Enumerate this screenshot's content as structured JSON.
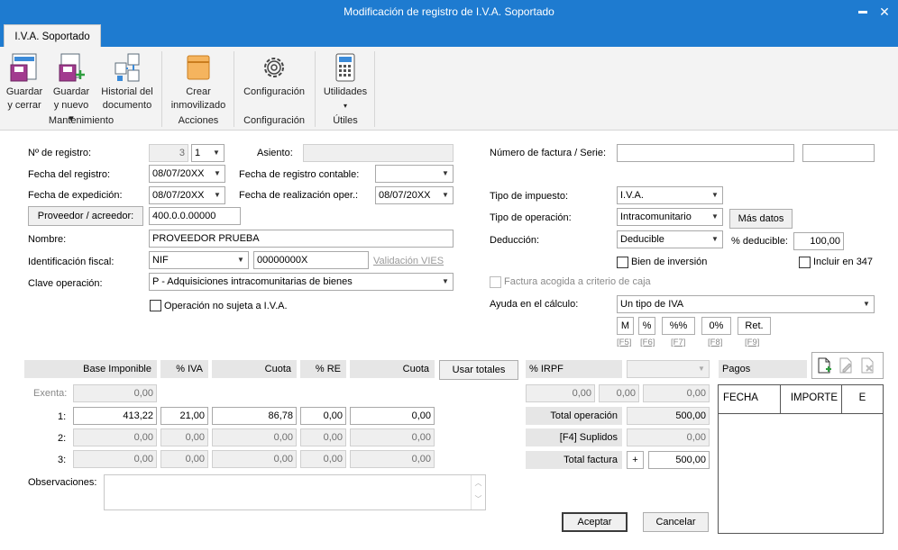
{
  "window": {
    "title": "Modificación de registro de I.V.A. Soportado",
    "minimize": "▬",
    "close": "✕"
  },
  "ribbon": {
    "tab": "I.V.A. Soportado",
    "buttons": {
      "guardar_cerrar": [
        "Guardar",
        "y cerrar"
      ],
      "guardar_nuevo": [
        "Guardar",
        "y nuevo ▾"
      ],
      "historial": [
        "Historial del",
        "documento"
      ],
      "crear": [
        "Crear",
        "inmovilizado"
      ],
      "config": [
        "Configuración"
      ],
      "utilidades": [
        "Utilidades",
        "▾"
      ]
    },
    "groups": {
      "mantenimiento": "Mantenimiento",
      "acciones": "Acciones",
      "configuracion": "Configuración",
      "utiles": "Útiles"
    }
  },
  "form": {
    "n_registro_label": "Nº de registro:",
    "n_registro": "3",
    "n_registro_serie": "1",
    "asiento_label": "Asiento:",
    "asiento": "",
    "fecha_registro_label": "Fecha del registro:",
    "fecha_registro": "08/07/20XX",
    "fecha_contable_label": "Fecha de registro contable:",
    "fecha_contable": "",
    "fecha_expedicion_label": "Fecha de expedición:",
    "fecha_expedicion": "08/07/20XX",
    "fecha_realizacion_label": "Fecha de realización oper.:",
    "fecha_realizacion": "08/07/20XX",
    "proveedor_button": "Proveedor / acreedor:",
    "proveedor_code": "400.0.0.00000",
    "nombre_label": "Nombre:",
    "nombre": "PROVEEDOR PRUEBA",
    "ident_label": "Identificación fiscal:",
    "ident_tipo": "NIF",
    "ident_num": "00000000X",
    "vies_link": "Validación VIES",
    "clave_label": "Clave operación:",
    "clave": "P - Adquisiciones intracomunitarias de bienes",
    "no_sujeta_label": "Operación no sujeta a I.V.A.",
    "factura_label": "Número de factura / Serie:",
    "factura": "",
    "serie": "",
    "tipo_impuesto_label": "Tipo de impuesto:",
    "tipo_impuesto": "I.V.A.",
    "tipo_operacion_label": "Tipo de operación:",
    "tipo_operacion": "Intracomunitario",
    "mas_datos": "Más datos",
    "deduccion_label": "Deducción:",
    "deduccion": "Deducible",
    "pct_deducible_label": "% deducible:",
    "pct_deducible": "100,00",
    "bien_inversion_label": "Bien de inversión",
    "incluir_347_label": "Incluir en 347",
    "criterio_caja_label": "Factura acogida a criterio de caja",
    "ayuda_label": "Ayuda en el cálculo:",
    "ayuda": "Un tipo de IVA",
    "calc_buttons": [
      {
        "label": "M",
        "key": "[F5]"
      },
      {
        "label": "%",
        "key": "[F6]"
      },
      {
        "label": "%%",
        "key": "[F7]"
      },
      {
        "label": "0%",
        "key": "[F8]"
      },
      {
        "label": "Ret.",
        "key": "[F9]"
      }
    ]
  },
  "grid": {
    "headers": {
      "base": "Base Imponible",
      "iva": "% IVA",
      "cuota": "Cuota",
      "re": "% RE",
      "cuota_re": "Cuota"
    },
    "usar_totales": "Usar totales",
    "exenta_label": "Exenta:",
    "exenta": "0,00",
    "rows": [
      {
        "label": "1:",
        "base": "413,22",
        "iva": "21,00",
        "cuota": "86,78",
        "re": "0,00",
        "cuota_re": "0,00"
      },
      {
        "label": "2:",
        "base": "0,00",
        "iva": "0,00",
        "cuota": "0,00",
        "re": "0,00",
        "cuota_re": "0,00"
      },
      {
        "label": "3:",
        "base": "0,00",
        "iva": "0,00",
        "cuota": "0,00",
        "re": "0,00",
        "cuota_re": "0,00"
      }
    ]
  },
  "irpf": {
    "label": "% IRPF",
    "select": "",
    "v1": "0,00",
    "v2": "0,00",
    "v3": "0,00"
  },
  "totals": {
    "total_operacion_label": "Total operación",
    "total_operacion": "500,00",
    "suplidos_label": "[F4] Suplidos",
    "suplidos": "0,00",
    "total_factura_label": "Total factura",
    "plus": "+",
    "total_factura": "500,00"
  },
  "pagos": {
    "title": "Pagos",
    "cols": [
      "FECHA",
      "IMPORTE",
      "E"
    ]
  },
  "observaciones_label": "Observaciones:",
  "actions": {
    "aceptar": "Aceptar",
    "cancelar": "Cancelar"
  }
}
